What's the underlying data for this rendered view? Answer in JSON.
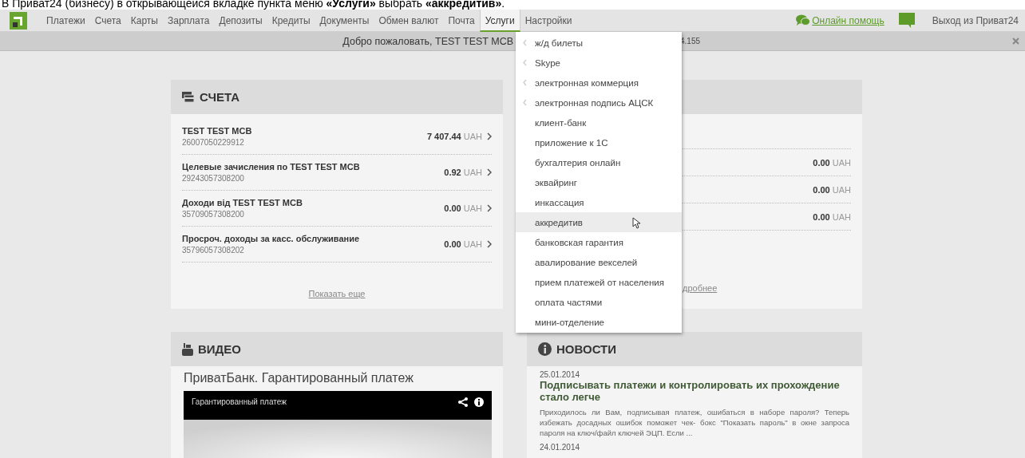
{
  "caption": "В Приват24 (бизнесу) в открывающейся вкладке пункта меню **«Услуги»** выбрать **«аккредитив»**.",
  "nav": {
    "items": [
      {
        "label": "Платежи",
        "selected": false
      },
      {
        "label": "Счета",
        "selected": false
      },
      {
        "label": "Карты",
        "selected": false
      },
      {
        "label": "Зарплата",
        "selected": false
      },
      {
        "label": "Депозиты",
        "selected": false
      },
      {
        "label": "Кредиты",
        "selected": false
      },
      {
        "label": "Документы",
        "selected": false
      },
      {
        "label": "Обмен валют",
        "selected": false
      },
      {
        "label": "Почта",
        "selected": false
      },
      {
        "label": "Услуги",
        "selected": true
      },
      {
        "label": "Настройки",
        "selected": false
      }
    ],
    "help_link": "Онлайн помощь",
    "logout": "Выход из Приват24"
  },
  "welcome": {
    "text": "Добро пожаловать, TEST TEST MCB",
    "tail": "4.155"
  },
  "services_menu": {
    "items": [
      {
        "label": "ж/д билеты",
        "submenu": true,
        "selected": false
      },
      {
        "label": "Skype",
        "submenu": true,
        "selected": false
      },
      {
        "label": "электронная коммерция",
        "submenu": true,
        "selected": false
      },
      {
        "label": "электронная подпись АЦСК",
        "submenu": true,
        "selected": false
      },
      {
        "label": "клиент-банк",
        "submenu": false,
        "selected": false
      },
      {
        "label": "приложение к 1С",
        "submenu": false,
        "selected": false
      },
      {
        "label": "бухгалтерия онлайн",
        "submenu": false,
        "selected": false
      },
      {
        "label": "эквайринг",
        "submenu": false,
        "selected": false
      },
      {
        "label": "инкассация",
        "submenu": false,
        "selected": false
      },
      {
        "label": "аккредитив",
        "submenu": false,
        "selected": true
      },
      {
        "label": "банковская гарантия",
        "submenu": false,
        "selected": false
      },
      {
        "label": "авалирование векселей",
        "submenu": false,
        "selected": false
      },
      {
        "label": "прием платежей от населения",
        "submenu": false,
        "selected": false
      },
      {
        "label": "оплата частями",
        "submenu": false,
        "selected": false
      },
      {
        "label": "мини-отделение",
        "submenu": false,
        "selected": false
      }
    ]
  },
  "accounts": {
    "title": "СЧЕТА",
    "rows": [
      {
        "name": "TEST TEST MCB",
        "number": "26007050229912",
        "amount": "7 407.44",
        "currency": "UAH"
      },
      {
        "name": "Целевые зачисления по TEST TEST MCB",
        "number": "29243057308200",
        "amount": "0.92",
        "currency": "UAH"
      },
      {
        "name": "Доходи від TEST TEST MCB",
        "number": "35709057308200",
        "amount": "0.00",
        "currency": "UAH"
      },
      {
        "name": "Просроч. доходы за касс. обслуживание",
        "number": "35796057308202",
        "amount": "0.00",
        "currency": "UAH"
      }
    ],
    "more": "Показать еще"
  },
  "side_card": {
    "rows": [
      {
        "amount": "0.00",
        "currency": "UAH"
      },
      {
        "amount": "0.00",
        "currency": "UAH"
      },
      {
        "amount": "0.00",
        "currency": "UAH"
      }
    ],
    "link": "дробнее"
  },
  "video": {
    "title": "ВИДЕО",
    "caption": "ПриватБанк. Гарантированный платеж",
    "player_title": "Гарантированный платеж"
  },
  "news": {
    "title": "НОВОСТИ",
    "items": [
      {
        "date": "25.01.2014",
        "headline": "Подписывать платежи и контролировать их прохождение стало легче",
        "text": "Приходилось ли Вам, подписывая платеж, ошибаться в наборе пароля? Теперь избежать досадных ошибок поможет чек- бокс \"Показать пароль\" в окне запроса пароля на ключ/файл ключей ЭЦП. Если ..."
      },
      {
        "date": "24.01.2014"
      }
    ]
  }
}
